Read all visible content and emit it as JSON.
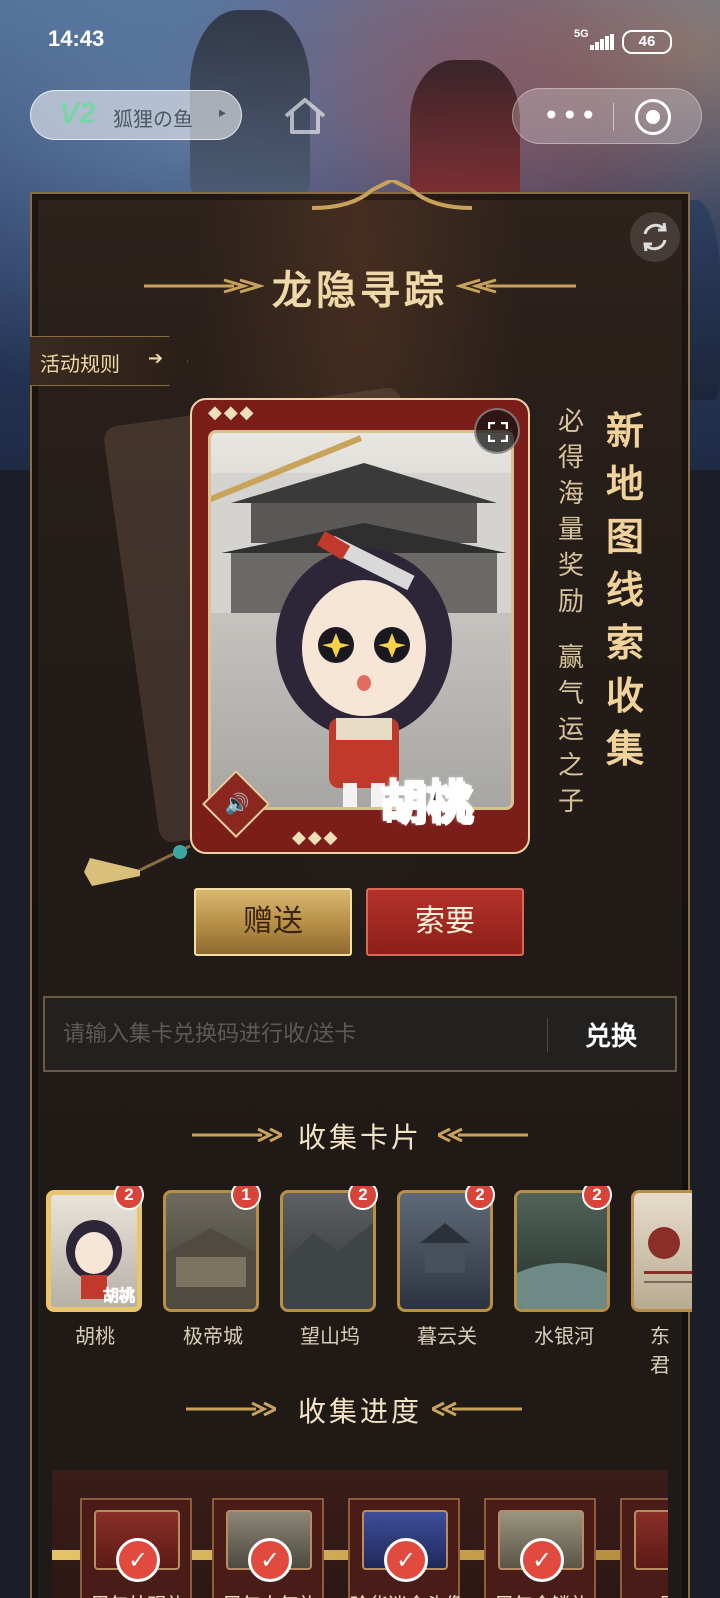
{
  "status_bar": {
    "time": "14:43",
    "network": "5G",
    "battery": "46"
  },
  "top_bar": {
    "user_badge": "V2",
    "user_name": "狐狸の鱼",
    "user_arrow": "▸"
  },
  "page": {
    "title": "龙隐寻踪",
    "rules_label": "活动规则",
    "rules_arrow": "➔"
  },
  "featured_card": {
    "name": "胡桃",
    "diamonds": "◆◆◆"
  },
  "slogans": {
    "small_top": "必得海量奖励",
    "small_bottom": "赢气运之子",
    "big": "新地图线索收集"
  },
  "actions": {
    "gift_label": "赠送",
    "ask_label": "索要"
  },
  "redeem": {
    "placeholder": "请输入集卡兑换码进行收/送卡",
    "value": "",
    "button_label": "兑换"
  },
  "collect": {
    "heading": "收集卡片",
    "cards": [
      {
        "name": "胡桃",
        "count": "2",
        "selected": true
      },
      {
        "name": "极帝城",
        "count": "1",
        "selected": false
      },
      {
        "name": "望山坞",
        "count": "2",
        "selected": false
      },
      {
        "name": "暮云关",
        "count": "2",
        "selected": false
      },
      {
        "name": "水银河",
        "count": "2",
        "selected": false
      },
      {
        "name": "东君",
        "count": "",
        "selected": false
      }
    ]
  },
  "progress": {
    "heading": "收集进度",
    "rewards": [
      {
        "label": "周年外观礼",
        "claimed": true
      },
      {
        "label": "周年人气礼",
        "claimed": true
      },
      {
        "label": "珍华迷金头像",
        "claimed": true
      },
      {
        "label": "周年金鳞礼",
        "claimed": true
      },
      {
        "label": "周年",
        "claimed": false
      }
    ]
  },
  "colors": {
    "accent_gold": "#d9b770",
    "accent_red": "#b4322a",
    "badge_red": "#d9433a"
  }
}
